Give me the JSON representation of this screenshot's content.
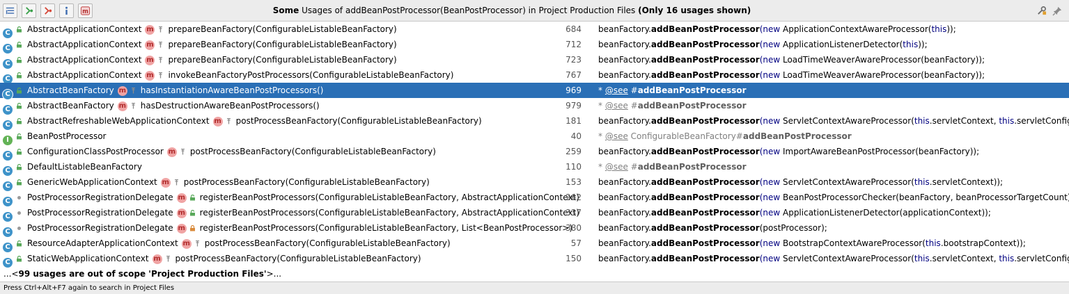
{
  "header": {
    "title_prefix": "Some",
    "title_middle": " Usages of addBeanPostProcessor(BeanPostProcessor) in Project Production Files ",
    "title_suffix": "(Only 16 usages shown)"
  },
  "toolbar": {
    "icons": [
      "expand-all-icon",
      "next-occurrence-icon",
      "previous-occurrence-icon",
      "info-icon",
      "method-filter-icon"
    ],
    "right_icons": [
      "settings-icon",
      "pin-icon"
    ]
  },
  "rows": [
    {
      "cls": "AbstractApplicationContext",
      "method": "prepareBeanFactory(ConfigurableListableBeanFactory)",
      "line": "684",
      "pre": "beanFactory.",
      "bold": "addBeanPostProcessor",
      "kw1": "(new",
      "mid": " ApplicationContextAwareProcessor(",
      "kw2": "this",
      "post": "));"
    },
    {
      "cls": "AbstractApplicationContext",
      "method": "prepareBeanFactory(ConfigurableListableBeanFactory)",
      "line": "712",
      "pre": "beanFactory.",
      "bold": "addBeanPostProcessor",
      "kw1": "(new",
      "mid": " ApplicationListenerDetector(",
      "kw2": "this",
      "post": "));"
    },
    {
      "cls": "AbstractApplicationContext",
      "method": "prepareBeanFactory(ConfigurableListableBeanFactory)",
      "line": "723",
      "pre": "beanFactory.",
      "bold": "addBeanPostProcessor",
      "kw1": "(new",
      "mid": " LoadTimeWeaverAwareProcessor(beanFactory));",
      "kw2": "",
      "post": ""
    },
    {
      "cls": "AbstractApplicationContext",
      "method": "invokeBeanFactoryPostProcessors(ConfigurableListableBeanFactory)",
      "line": "767",
      "pre": "beanFactory.",
      "bold": "addBeanPostProcessor",
      "kw1": "(new",
      "mid": " LoadTimeWeaverAwareProcessor(beanFactory));",
      "kw2": "",
      "post": ""
    },
    {
      "cls": "AbstractBeanFactory",
      "method": "hasInstantiationAwareBeanPostProcessors()",
      "line": "969",
      "cm_prefix": "* ",
      "cm_link": "@see",
      "cm_mid": " #",
      "cm_bold": "addBeanPostProcessor",
      "selected": true
    },
    {
      "cls": "AbstractBeanFactory",
      "method": "hasDestructionAwareBeanPostProcessors()",
      "line": "979",
      "cm_prefix": "* ",
      "cm_link": "@see",
      "cm_mid": " #",
      "cm_bold": "addBeanPostProcessor"
    },
    {
      "cls": "AbstractRefreshableWebApplicationContext",
      "method": "postProcessBeanFactory(ConfigurableListableBeanFactory)",
      "line": "181",
      "pre": "beanFactory.",
      "bold": "addBeanPostProcessor",
      "kw1": "(new",
      "mid": " ServletContextAwareProcessor(",
      "kw2": "this",
      "post": ".servletContext, ",
      "kw3": "this",
      "post2": ".servletConfig));"
    },
    {
      "cls": "BeanPostProcessor",
      "method": "",
      "line": "40",
      "cm_prefix": "* ",
      "cm_link": "@see",
      "cm_mid": " ConfigurableBeanFactory#",
      "cm_bold": "addBeanPostProcessor",
      "interface": true
    },
    {
      "cls": "ConfigurationClassPostProcessor",
      "method": "postProcessBeanFactory(ConfigurableListableBeanFactory)",
      "line": "259",
      "pre": "beanFactory.",
      "bold": "addBeanPostProcessor",
      "kw1": "(new",
      "mid": " ImportAwareBeanPostProcessor(beanFactory));",
      "kw2": "",
      "post": ""
    },
    {
      "cls": "DefaultListableBeanFactory",
      "method": "",
      "line": "110",
      "cm_prefix": "* ",
      "cm_link": "@see",
      "cm_mid": " #",
      "cm_bold": "addBeanPostProcessor"
    },
    {
      "cls": "GenericWebApplicationContext",
      "method": "postProcessBeanFactory(ConfigurableListableBeanFactory)",
      "line": "153",
      "pre": "beanFactory.",
      "bold": "addBeanPostProcessor",
      "kw1": "(new",
      "mid": " ServletContextAwareProcessor(",
      "kw2": "this",
      "post": ".servletContext));"
    },
    {
      "cls": "PostProcessorRegistrationDelegate",
      "method": "registerBeanPostProcessors(ConfigurableListableBeanFactory, AbstractApplicationContext)",
      "line": "262",
      "pre": "beanFactory.",
      "bold": "addBeanPostProcessor",
      "kw1": "(new",
      "mid": " BeanPostProcessorChecker(beanFactory, beanProcessorTargetCount));",
      "kw2": "",
      "post": "",
      "static": true
    },
    {
      "cls": "PostProcessorRegistrationDelegate",
      "method": "registerBeanPostProcessors(ConfigurableListableBeanFactory, AbstractApplicationContext)",
      "line": "337",
      "pre": "beanFactory.",
      "bold": "addBeanPostProcessor",
      "kw1": "(new",
      "mid": " ApplicationListenerDetector(applicationContext));",
      "kw2": "",
      "post": "",
      "static": true
    },
    {
      "cls": "PostProcessorRegistrationDelegate",
      "method": "registerBeanPostProcessors(ConfigurableListableBeanFactory, List<BeanPostProcessor>)",
      "line": "380",
      "pre": "beanFactory.",
      "bold": "addBeanPostProcessor",
      "kw1": "",
      "mid": "(postProcessor);",
      "kw2": "",
      "post": "",
      "static": true,
      "private": true
    },
    {
      "cls": "ResourceAdapterApplicationContext",
      "method": "postProcessBeanFactory(ConfigurableListableBeanFactory)",
      "line": "57",
      "pre": "beanFactory.",
      "bold": "addBeanPostProcessor",
      "kw1": "(new",
      "mid": " BootstrapContextAwareProcessor(",
      "kw2": "this",
      "post": ".bootstrapContext));"
    },
    {
      "cls": "StaticWebApplicationContext",
      "method": "postProcessBeanFactory(ConfigurableListableBeanFactory)",
      "line": "150",
      "pre": "beanFactory.",
      "bold": "addBeanPostProcessor",
      "kw1": "(new",
      "mid": " ServletContextAwareProcessor(",
      "kw2": "this",
      "post": ".servletContext, ",
      "kw3": "this",
      "post2": ".servletConfig));"
    }
  ],
  "footer": {
    "prefix": "...<",
    "bold": "99 usages are out of scope 'Project Production Files'",
    "suffix": ">..."
  },
  "status": {
    "text": "Press Ctrl+Alt+F7 again to search in Project Files"
  },
  "colors": {
    "selection": "#2a6fb6",
    "class_icon": "#3e93c9",
    "interface_icon": "#63b356",
    "method_badge": "#f0a4a4",
    "keyword": "#000080"
  }
}
